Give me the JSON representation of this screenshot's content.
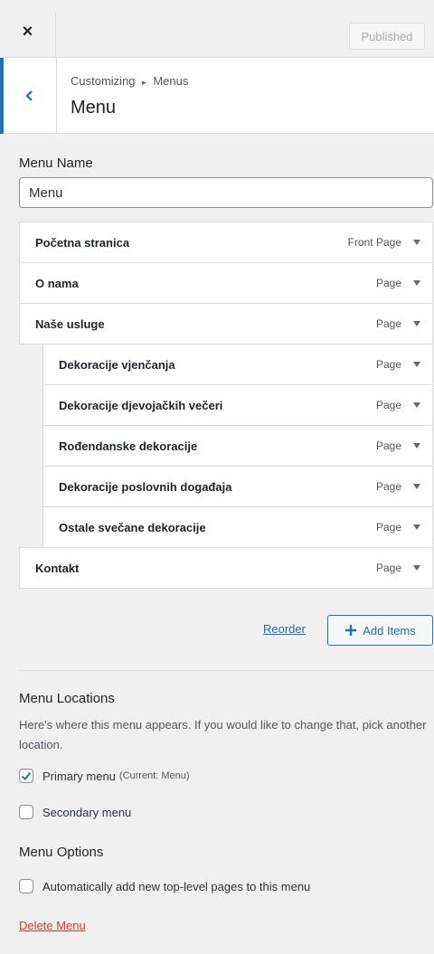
{
  "topbar": {
    "close_symbol": "×",
    "publish_label": "Published"
  },
  "header": {
    "breadcrumb_parent": "Customizing",
    "breadcrumb_sep": "▸",
    "breadcrumb_current": "Menus",
    "title": "Menu"
  },
  "menu_name": {
    "label": "Menu Name",
    "value": "Menu"
  },
  "menu_items": [
    {
      "title": "Početna stranica",
      "type": "Front Page",
      "level": 0
    },
    {
      "title": "O nama",
      "type": "Page",
      "level": 0
    },
    {
      "title": "Naše usluge",
      "type": "Page",
      "level": 0
    },
    {
      "title": "Dekoracije vjenčanja",
      "type": "Page",
      "level": 1
    },
    {
      "title": "Dekoracije djevojačkih večeri",
      "type": "Page",
      "level": 1
    },
    {
      "title": "Rođendanske dekoracije",
      "type": "Page",
      "level": 1
    },
    {
      "title": "Dekoracije poslovnih događaja",
      "type": "Page",
      "level": 1
    },
    {
      "title": "Ostale svečane dekoracije",
      "type": "Page",
      "level": 1
    },
    {
      "title": "Kontakt",
      "type": "Page",
      "level": 0
    }
  ],
  "actions": {
    "reorder": "Reorder",
    "add_items": "Add Items"
  },
  "locations": {
    "heading": "Menu Locations",
    "description": "Here's where this menu appears. If you would like to change that, pick another location.",
    "primary_label": "Primary menu",
    "primary_note": "(Current: Menu)",
    "primary_checked": true,
    "secondary_label": "Secondary menu",
    "secondary_checked": false
  },
  "options": {
    "heading": "Menu Options",
    "auto_add_label": "Automatically add new top-level pages to this menu",
    "auto_add_checked": false
  },
  "delete_label": "Delete Menu",
  "colors": {
    "accent": "#2271b1",
    "danger": "#d63638",
    "background": "#f0f0f1"
  }
}
